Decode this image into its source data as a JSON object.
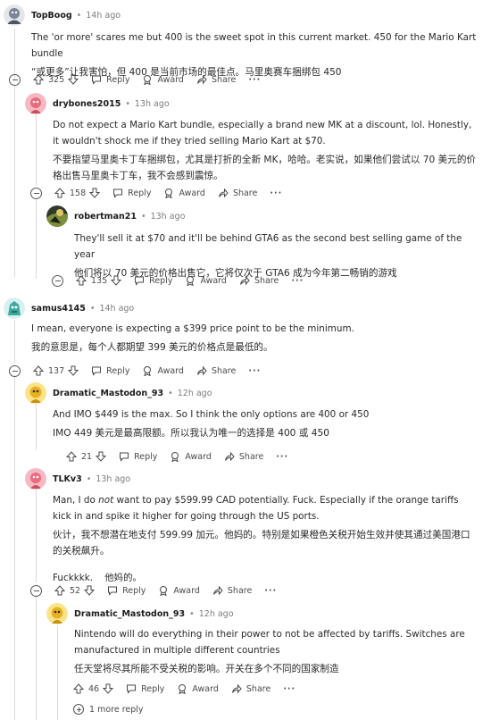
{
  "labels": {
    "reply": "Reply",
    "award": "Award",
    "share": "Share",
    "more_replies": "1 more reply"
  },
  "comments": [
    {
      "user": "TopBoog",
      "time": "14h ago",
      "en": "The 'or more' scares me but 400 is the sweet spot in this current market. 450 for the Mario Kart bundle",
      "zh": "“或更多”让我害怕，但 400 是当前市场的最佳点。马里奥赛车捆绑包 450",
      "score": "325"
    },
    {
      "user": "drybones2015",
      "time": "13h ago",
      "en": "Do not expect a Mario Kart bundle, especially a brand new MK at a discount, lol. Honestly, it wouldn't shock me if they tried selling Mario Kart at $70.",
      "zh": "不要指望马里奥卡丁车捆绑包，尤其是打折的全新 MK，哈哈。老实说，如果他们尝试以 70 美元的价格出售马里奥卡丁车，我不会感到震惊。",
      "score": "158"
    },
    {
      "user": "robertman21",
      "time": "13h ago",
      "en": "They'll sell it at $70 and it'll be behind GTA6 as the second best selling game of the year",
      "zh": "他们将以 70 美元的价格出售它，它将仅次于 GTA6 成为今年第二畅销的游戏",
      "score": "135"
    },
    {
      "user": "samus4145",
      "time": "14h ago",
      "en": "I mean, everyone is expecting a $399 price point to be the minimum.",
      "zh": "我的意思是，每个人都期望 399 美元的价格点是最低的。",
      "score": "137"
    },
    {
      "user": "Dramatic_Mastodon_93",
      "time": "12h ago",
      "en": "And IMO $449 is the max. So I think the only options are 400 or 450",
      "zh": "IMO 449 美元是最高限额。所以我认为唯一的选择是 400 或 450",
      "score": "21"
    },
    {
      "user": "TLKv3",
      "time": "13h ago",
      "en_pre": "Man, I do ",
      "en_em": "not",
      "en_post": " want to pay $599.99 CAD potentially. Fuck. Especially if the orange tariffs kick in and spike it higher for going through the US ports.",
      "zh": "伙计，我不想潜在地支付 599.99 加元。他妈的。特别是如果橙色关税开始生效并使其通过美国港口的关税飙升。",
      "extra": "Fuckkkk.    他妈的。",
      "score": "52"
    },
    {
      "user": "Dramatic_Mastodon_93",
      "time": "12h ago",
      "en": "Nintendo will do everything in their power to not be affected by tariffs. Switches are manufactured in multiple different countries",
      "zh": "任天堂将尽其所能不受关税的影响。开关在多个不同的国家制造",
      "score": "46"
    }
  ]
}
